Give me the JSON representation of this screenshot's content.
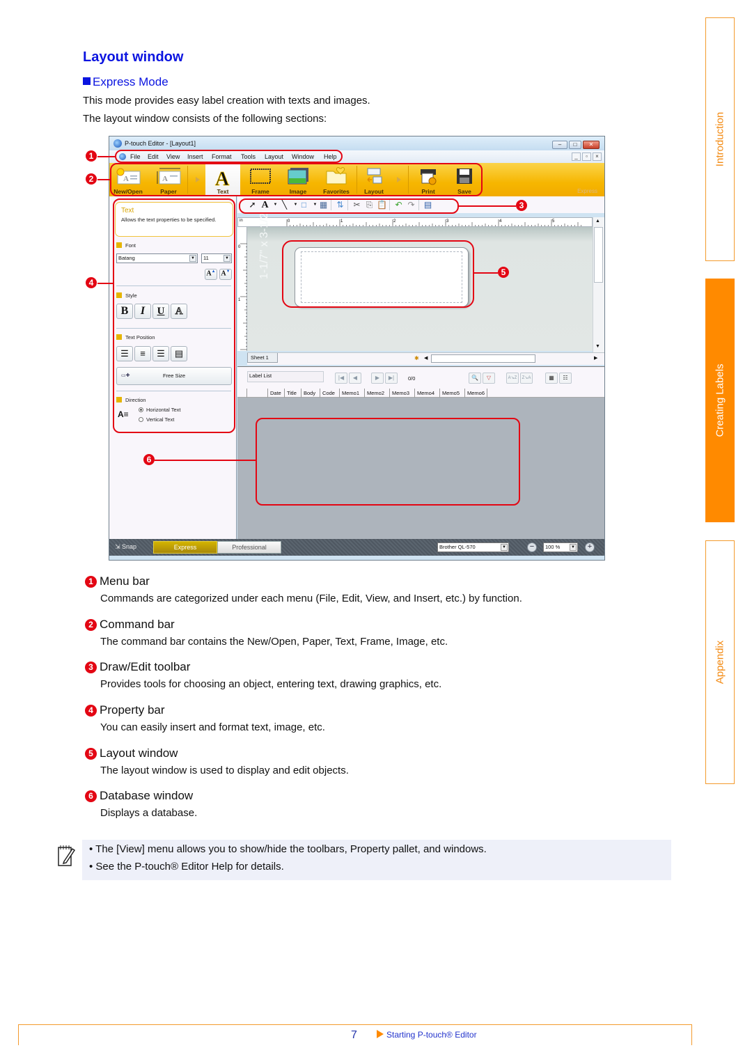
{
  "page": {
    "title": "Layout window",
    "subtitle": "Express Mode",
    "intro_lines": [
      "This mode provides easy label creation with texts and images.",
      "The layout window consists of the following sections:"
    ]
  },
  "side_tabs": [
    {
      "label": "Introduction",
      "active": false
    },
    {
      "label": "Creating Labels",
      "active": true
    },
    {
      "label": "Appendix",
      "active": false
    }
  ],
  "app": {
    "window_title": "P-touch Editor - [Layout1]",
    "window_buttons": [
      "minimize",
      "maximize",
      "close"
    ],
    "menu": [
      "File",
      "Edit",
      "View",
      "Insert",
      "Format",
      "Tools",
      "Layout",
      "Window",
      "Help"
    ],
    "commands": [
      "New/Open",
      "Paper",
      "Text",
      "Frame",
      "Image",
      "Favorites",
      "Layout",
      "Print",
      "Save"
    ],
    "selected_command": "Text",
    "mode_watermark": "Express",
    "property": {
      "card_title": "Text",
      "card_desc": "Allows the text properties to be specified.",
      "font_label": "Font",
      "font_value": "Batang",
      "size_value": "11",
      "style_label": "Style",
      "style_buttons": [
        "B",
        "I",
        "U",
        "A"
      ],
      "text_position_label": "Text Position",
      "free_size_label": "Free Size",
      "direction_label": "Direction",
      "direction_options": [
        "Horizontal Text",
        "Vertical Text"
      ],
      "direction_selected": "Horizontal Text"
    },
    "ruler": {
      "unit": "in",
      "h_ticks": [
        "0",
        "1",
        "2",
        "3",
        "4",
        "5"
      ],
      "v_ticks": [
        "0",
        "1"
      ]
    },
    "label_size_hint": "1-1/7\" x 3-1/2\"",
    "sheet_tab": "Sheet 1",
    "database": {
      "label_list": "Label List",
      "record_count": "0/0",
      "columns": [
        "Date",
        "Title",
        "Body",
        "Code",
        "Memo1",
        "Memo2",
        "Memo3",
        "Memo4",
        "Memo5",
        "Memo6"
      ]
    },
    "status": {
      "snap": "Snap",
      "express": "Express",
      "professional": "Professional",
      "printer": "Brother QL-570",
      "zoom": "100 %"
    }
  },
  "callouts": [
    "1",
    "2",
    "3",
    "4",
    "5",
    "6"
  ],
  "items": [
    {
      "num": "1",
      "title": "Menu bar",
      "desc": "Commands are categorized under each menu (File, Edit, View, and Insert, etc.) by function."
    },
    {
      "num": "2",
      "title": "Command bar",
      "desc": "The command bar contains the New/Open, Paper, Text, Frame, Image, etc."
    },
    {
      "num": "3",
      "title": "Draw/Edit toolbar",
      "desc": "Provides tools for choosing an object, entering text, drawing graphics, etc."
    },
    {
      "num": "4",
      "title": "Property bar",
      "desc": "You can easily insert and format text, image, etc."
    },
    {
      "num": "5",
      "title": "Layout window",
      "desc": "The layout window is used to display and edit objects."
    },
    {
      "num": "6",
      "title": "Database window",
      "desc": "Displays a database."
    }
  ],
  "note": {
    "lines": [
      "The [View] menu allows you to show/hide the toolbars, Property pallet, and windows.",
      "See the P-touch® Editor Help for details."
    ]
  },
  "footer": {
    "page_number": "7",
    "link": "Starting P-touch® Editor"
  },
  "colors": {
    "heading_blue": "#0b14e0",
    "callout_red": "#e30613",
    "tab_orange": "#ff8a00"
  }
}
